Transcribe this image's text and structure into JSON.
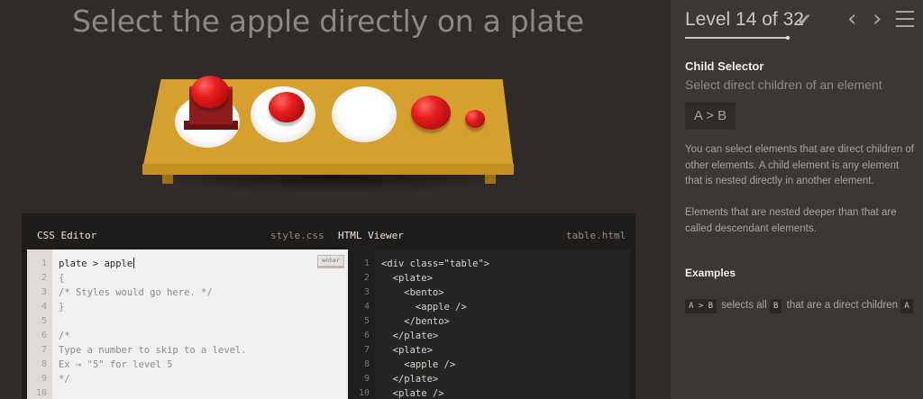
{
  "instruction": "Select the apple directly on a plate",
  "level": {
    "title": "Level 14 of 32",
    "current": 14,
    "total": 32,
    "progress_fraction": 0.4375,
    "completed": true
  },
  "lesson": {
    "selector_name": "Child Selector",
    "selector_title": "Select direct children of an element",
    "syntax": "A > B",
    "description_1": "You can select elements that are direct children of other elements. A child element is any element that is nested directly in another element.",
    "description_2": "Elements that are nested deeper than that are called descendant elements.",
    "examples_heading": "Examples",
    "example": {
      "code1": "A > B",
      "text1": "selects all",
      "code2": "B",
      "text2": "that are a direct children",
      "code3": "A"
    }
  },
  "editor": {
    "css_title": "CSS Editor",
    "css_file": "style.css",
    "html_title": "HTML Viewer",
    "html_file": "table.html",
    "enter_label": "enter",
    "css_input": "plate > apple",
    "css_lines": [
      "{",
      "/* Styles would go here. */",
      "}",
      "",
      "/*",
      "Type a number to skip to a level.",
      "Ex → \"5\" for level 5",
      "*/",
      ""
    ],
    "html_lines": [
      "<div class=\"table\">",
      "  <plate>",
      "    <bento>",
      "      <apple />",
      "    </bento>",
      "  </plate>",
      "  <plate>",
      "    <apple />",
      "  </plate>",
      "  <plate />"
    ],
    "line_numbers": [
      "1",
      "2",
      "3",
      "4",
      "5",
      "6",
      "7",
      "8",
      "9",
      "10"
    ]
  },
  "colors": {
    "table": "#d5a02e",
    "apple": "#e71d1d",
    "bento": "#8f1c1c",
    "plate": "#ffffff",
    "sidebar": "#3b3733"
  }
}
